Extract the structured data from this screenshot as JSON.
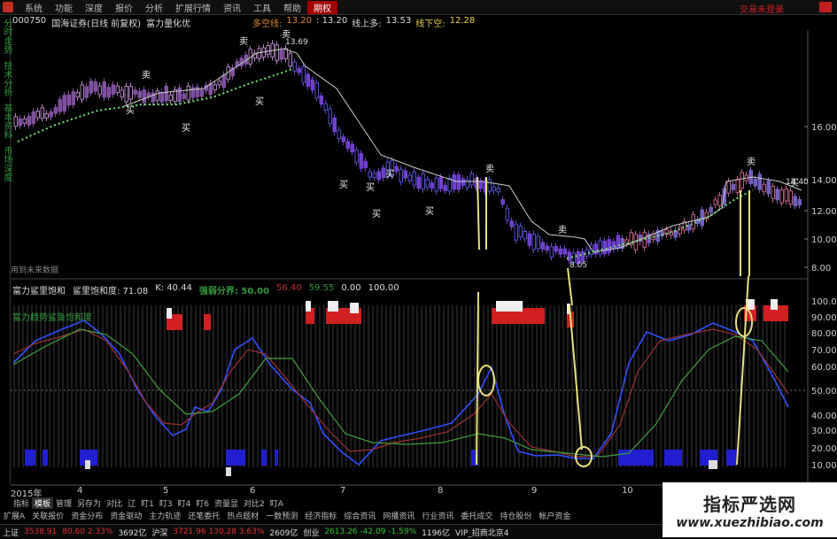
{
  "menu": {
    "items": [
      "系统",
      "功能",
      "深度",
      "报价",
      "分析",
      "扩展行情",
      "资讯",
      "工具",
      "帮助",
      "期权"
    ],
    "active_index": 9,
    "right_title": "交易未登录"
  },
  "left_tabs": [
    "分时走势",
    "技术分析",
    "基本资料",
    "市场深度"
  ],
  "stock": {
    "code": "000750",
    "name": "国海证券(日线 前复权)",
    "indicator": "富力量化优"
  },
  "top_labels": [
    {
      "text": "多空线:",
      "cls": "lab-o"
    },
    {
      "text": "13.20",
      "cls": "lab-o"
    },
    {
      "text": ": 13.20",
      "cls": "lab-g"
    },
    {
      "text": "线上多:",
      "cls": "lab-g"
    },
    {
      "text": "13.53",
      "cls": "lab-g"
    },
    {
      "text": "线下空:",
      "cls": "lab-y"
    },
    {
      "text": "12.28",
      "cls": "lab-y"
    }
  ],
  "price_axis": [
    "16.00",
    "14.00",
    "12.00",
    "10.00",
    "8.00"
  ],
  "price_marks": {
    "high": "13.69",
    "low": "8.05",
    "right_hi": "14.40"
  },
  "panel_label": "用到未来数据",
  "sub_header": {
    "a": "富力鲨里饱和",
    "b": "鲨里饱和度: 71.08",
    "c": "K: 40.44",
    "d": "强弱分界: 50.00",
    "e": "56.40",
    "f": "59.55",
    "g": "0.00",
    "h": "100.00"
  },
  "sub_title": "富力趋势鲨鱼饱和度",
  "osc_axis": [
    "100.00",
    "90.00",
    "80.00",
    "70.00",
    "60.00",
    "50.00",
    "40.00",
    "30.00",
    "20.00",
    "10.00"
  ],
  "dates": [
    "2015年",
    "4",
    "5",
    "6",
    "7",
    "8",
    "9",
    "10"
  ],
  "chart_tabs": [
    "指标",
    "模板",
    "管理",
    "另存为",
    "对比",
    "辽",
    "盯1",
    "盯3",
    "盯4",
    "盯6",
    "资量显",
    "对比2",
    "盯A"
  ],
  "chart_tab_selected": 1,
  "bottom_tabs": [
    "扩展A",
    "关联报价",
    "资金分布",
    "资金驱动",
    "主力轨迹",
    "还笔委托",
    "热点题材",
    "一数预测",
    "经济指标",
    "综合资讯",
    "网播资讯",
    "行业资讯",
    "委托成交",
    "持仓股份",
    "帐户资金"
  ],
  "status": [
    {
      "text": "上证",
      "cls": "wh"
    },
    {
      "text": "3538.91",
      "cls": "up"
    },
    {
      "text": "80.60 2.33%",
      "cls": "up"
    },
    {
      "text": "3692亿",
      "cls": "wh"
    },
    {
      "text": "沪深",
      "cls": "wh"
    },
    {
      "text": "3721.96 130.28 3.63%",
      "cls": "up"
    },
    {
      "text": "2609亿",
      "cls": "wh"
    },
    {
      "text": "创业",
      "cls": "wh"
    },
    {
      "text": "2613.26 -42.09 -1.59%",
      "cls": "dn"
    },
    {
      "text": "1196亿",
      "cls": "wh"
    },
    {
      "text": "VIP_招商北京4",
      "cls": "wh"
    }
  ],
  "annotations": {
    "buy": "买",
    "sell": "卖"
  },
  "watermark": {
    "title": "指标严选网",
    "url": "www.xuezhibiao.com"
  }
}
